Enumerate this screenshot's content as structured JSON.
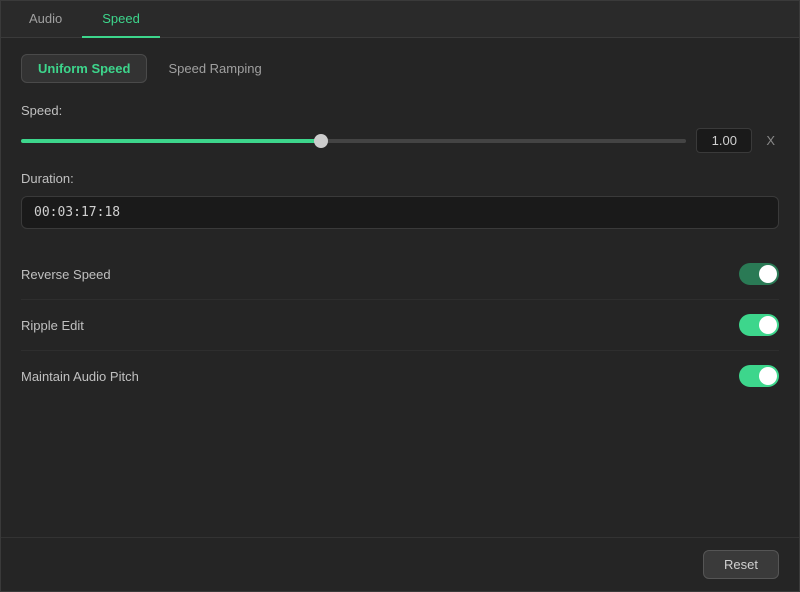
{
  "tabs": {
    "top": [
      {
        "id": "audio",
        "label": "Audio",
        "active": false
      },
      {
        "id": "speed",
        "label": "Speed",
        "active": true
      }
    ],
    "sub": [
      {
        "id": "uniform",
        "label": "Uniform Speed",
        "active": true
      },
      {
        "id": "ramping",
        "label": "Speed Ramping",
        "active": false
      }
    ]
  },
  "speed": {
    "label": "Speed:",
    "value": "1.00",
    "x_label": "X",
    "slider_percent": 45
  },
  "duration": {
    "label": "Duration:",
    "value": "00:03:17:18"
  },
  "toggles": [
    {
      "id": "reverse-speed",
      "label": "Reverse Speed",
      "state": "on-dark"
    },
    {
      "id": "ripple-edit",
      "label": "Ripple Edit",
      "state": "on"
    },
    {
      "id": "maintain-audio-pitch",
      "label": "Maintain Audio Pitch",
      "state": "on"
    }
  ],
  "footer": {
    "reset_label": "Reset"
  }
}
